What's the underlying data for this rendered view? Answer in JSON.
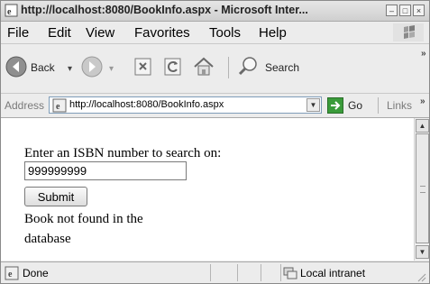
{
  "window": {
    "title": "http://localhost:8080/BookInfo.aspx - Microsoft Inter...",
    "minimize_label": "–",
    "maximize_label": "□",
    "close_label": "×"
  },
  "menu": {
    "items": [
      "File",
      "Edit",
      "View",
      "Favorites",
      "Tools",
      "Help"
    ]
  },
  "toolbar": {
    "back_label": "Back",
    "search_label": "Search",
    "overflow_label": "»",
    "icons": [
      "back-arrow-icon",
      "forward-arrow-icon",
      "stop-icon",
      "refresh-icon",
      "home-icon",
      "search-icon"
    ]
  },
  "address": {
    "label": "Address",
    "url": "http://localhost:8080/BookInfo.aspx",
    "go_label": "Go",
    "links_label": "Links",
    "overflow_label": "»"
  },
  "page": {
    "prompt": "Enter an ISBN number to search on:",
    "isbn_value": "999999999",
    "submit_label": "Submit",
    "result_line1": "Book not found in the",
    "result_line2": "database"
  },
  "status": {
    "text": "Done",
    "zone": "Local intranet"
  },
  "colors": {
    "go_green": "#3a9b3a",
    "back_green": "#3f9a3f",
    "window_bg": "#ececec"
  }
}
